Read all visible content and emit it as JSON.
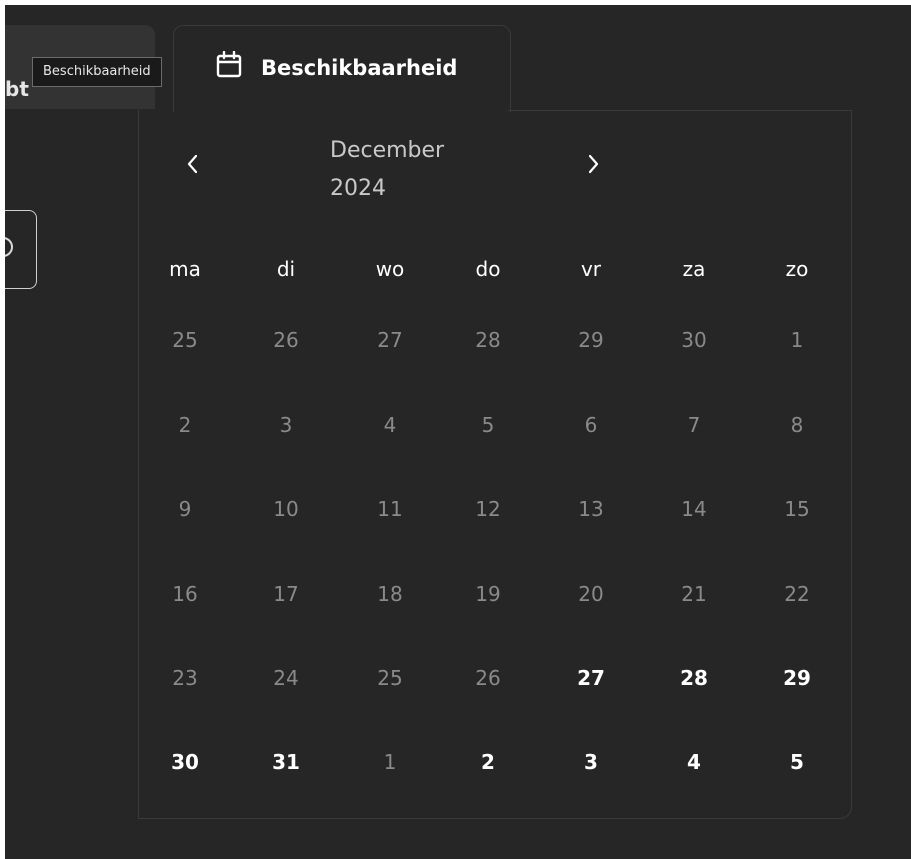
{
  "tabs": {
    "inactive_label_fragment": "bt",
    "active_label": "Beschikbaarheid"
  },
  "tooltip": "Beschikbaarheid",
  "calendar": {
    "month": "December",
    "year": "2024",
    "weekdays": [
      "ma",
      "di",
      "wo",
      "do",
      "vr",
      "za",
      "zo"
    ],
    "weeks": [
      [
        "25",
        "26",
        "27",
        "28",
        "29",
        "30",
        "1"
      ],
      [
        "2",
        "3",
        "4",
        "5",
        "6",
        "7",
        "8"
      ],
      [
        "9",
        "10",
        "11",
        "12",
        "13",
        "14",
        "15"
      ],
      [
        "16",
        "17",
        "18",
        "19",
        "20",
        "21",
        "22"
      ],
      [
        "23",
        "24",
        "25",
        "26",
        "27",
        "28",
        "29"
      ],
      [
        "30",
        "31",
        "1",
        "2",
        "3",
        "4",
        "5"
      ]
    ],
    "bold_days": [
      [
        4,
        4
      ],
      [
        4,
        5
      ],
      [
        4,
        6
      ],
      [
        5,
        0
      ],
      [
        5,
        1
      ],
      [
        5,
        3
      ],
      [
        5,
        4
      ],
      [
        5,
        5
      ],
      [
        5,
        6
      ]
    ]
  },
  "icons": {
    "tab": "calendar-icon",
    "prev": "chevron-left-icon",
    "next": "chevron-right-icon"
  }
}
